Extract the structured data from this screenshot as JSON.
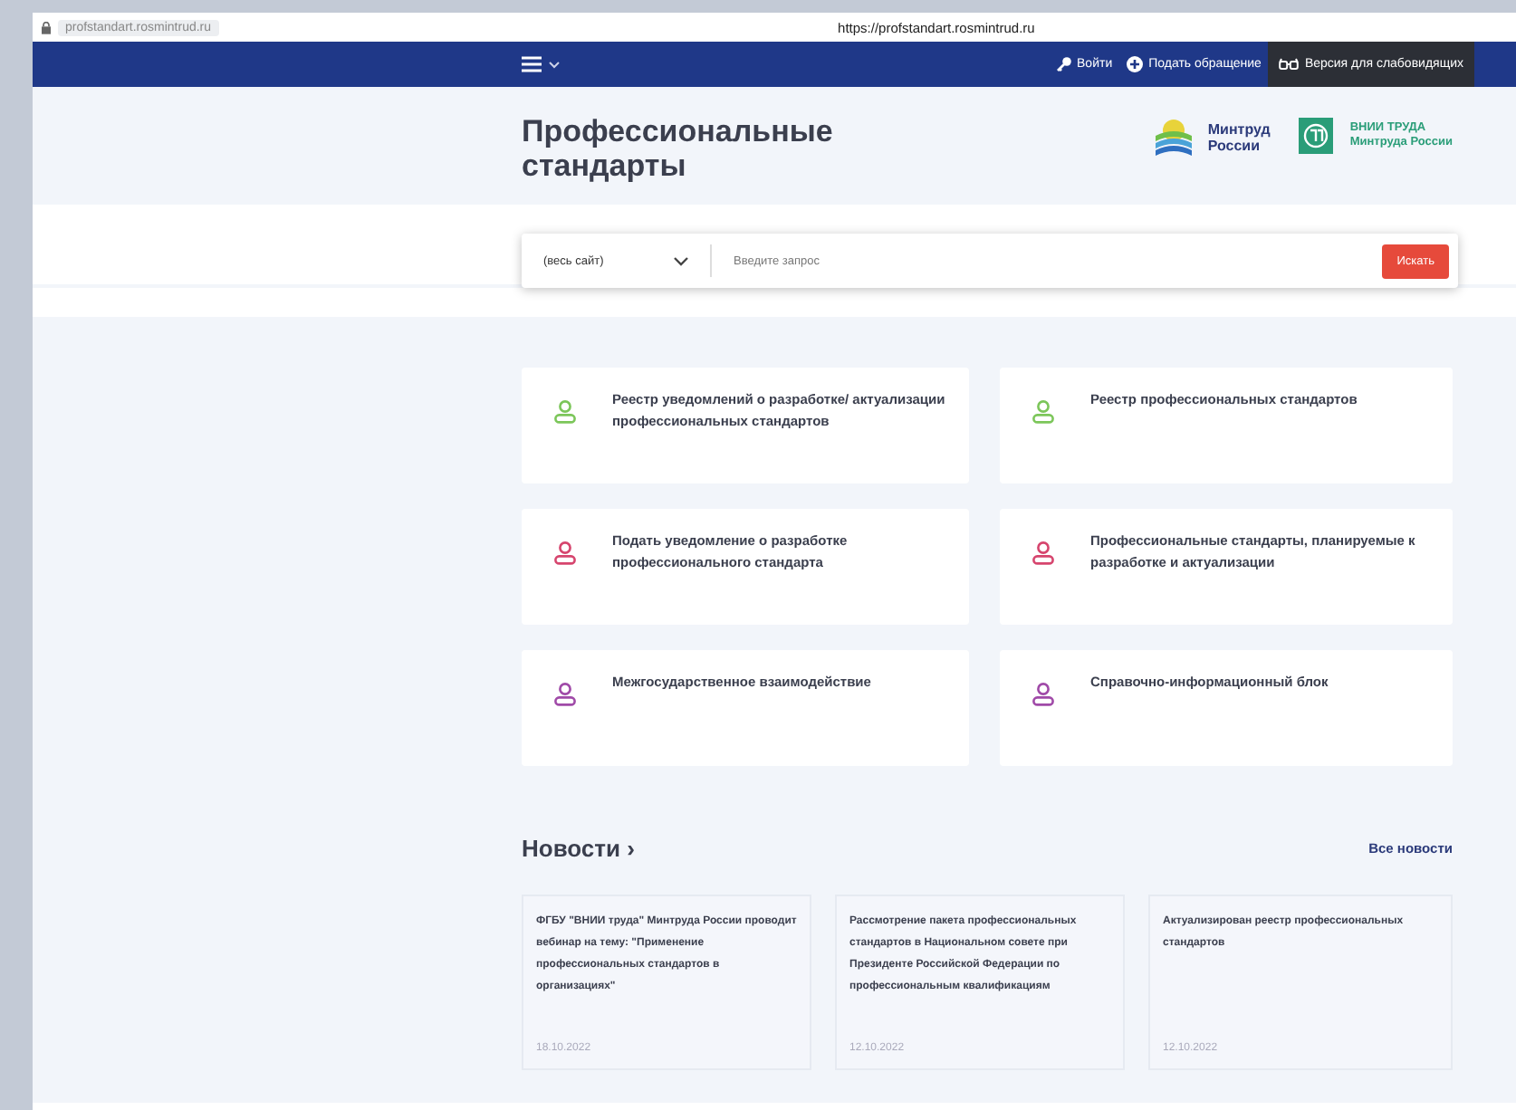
{
  "address_bar": {
    "site": "profstandart.rosmintrud.ru",
    "url": "https://profstandart.rosmintrud.ru"
  },
  "nav": {
    "links": [
      {
        "kind": "login",
        "label": "Войти"
      },
      {
        "kind": "appeal",
        "label": "Подать обращение"
      },
      {
        "kind": "accessible",
        "label": "Версия для слабовидящих"
      }
    ]
  },
  "header": {
    "title": "Профессиональные стандарты",
    "logos": [
      {
        "kind": "ministry",
        "line1": "Минтруд",
        "line2": "России"
      },
      {
        "kind": "institute",
        "line1": "ВНИИ ТРУДА",
        "line2": "Минтруда России"
      }
    ]
  },
  "search": {
    "scope": "(весь сайт)",
    "placeholder": "Введите запрос",
    "button": "Искать"
  },
  "cards": [
    {
      "title": "Реестр уведомлений о разработке/ актуализации профессиональных стандартов",
      "color": "#7cc65a"
    },
    {
      "title": "Реестр профессиональных стандартов",
      "color": "#7cc65a"
    },
    {
      "title": "Подать уведомление о разработке профессионального стандарта",
      "color": "#d6456e"
    },
    {
      "title": "Профессиональные стандарты, планируемые к разработке и актуализации",
      "color": "#d6456e"
    },
    {
      "title": "Межгосударственное взаимодействие",
      "color": "#a04aa8"
    },
    {
      "title": "Справочно-информационный блок",
      "color": "#a04aa8"
    }
  ],
  "news": {
    "heading": "Новости ›",
    "all_link": "Все новости",
    "items": [
      {
        "title": "ФГБУ \"ВНИИ труда\" Минтруда России проводит вебинар на тему: \"Применение профессиональных стандартов в организациях\"",
        "date": "18.10.2022"
      },
      {
        "title": "Рассмотрение пакета профессиональных стандартов в Национальном совете при Президенте Российской Федерации по профессиональным квалификациям",
        "date": "12.10.2022"
      },
      {
        "title": "Актуализирован реестр профессиональных стандартов",
        "date": "12.10.2022"
      }
    ]
  }
}
